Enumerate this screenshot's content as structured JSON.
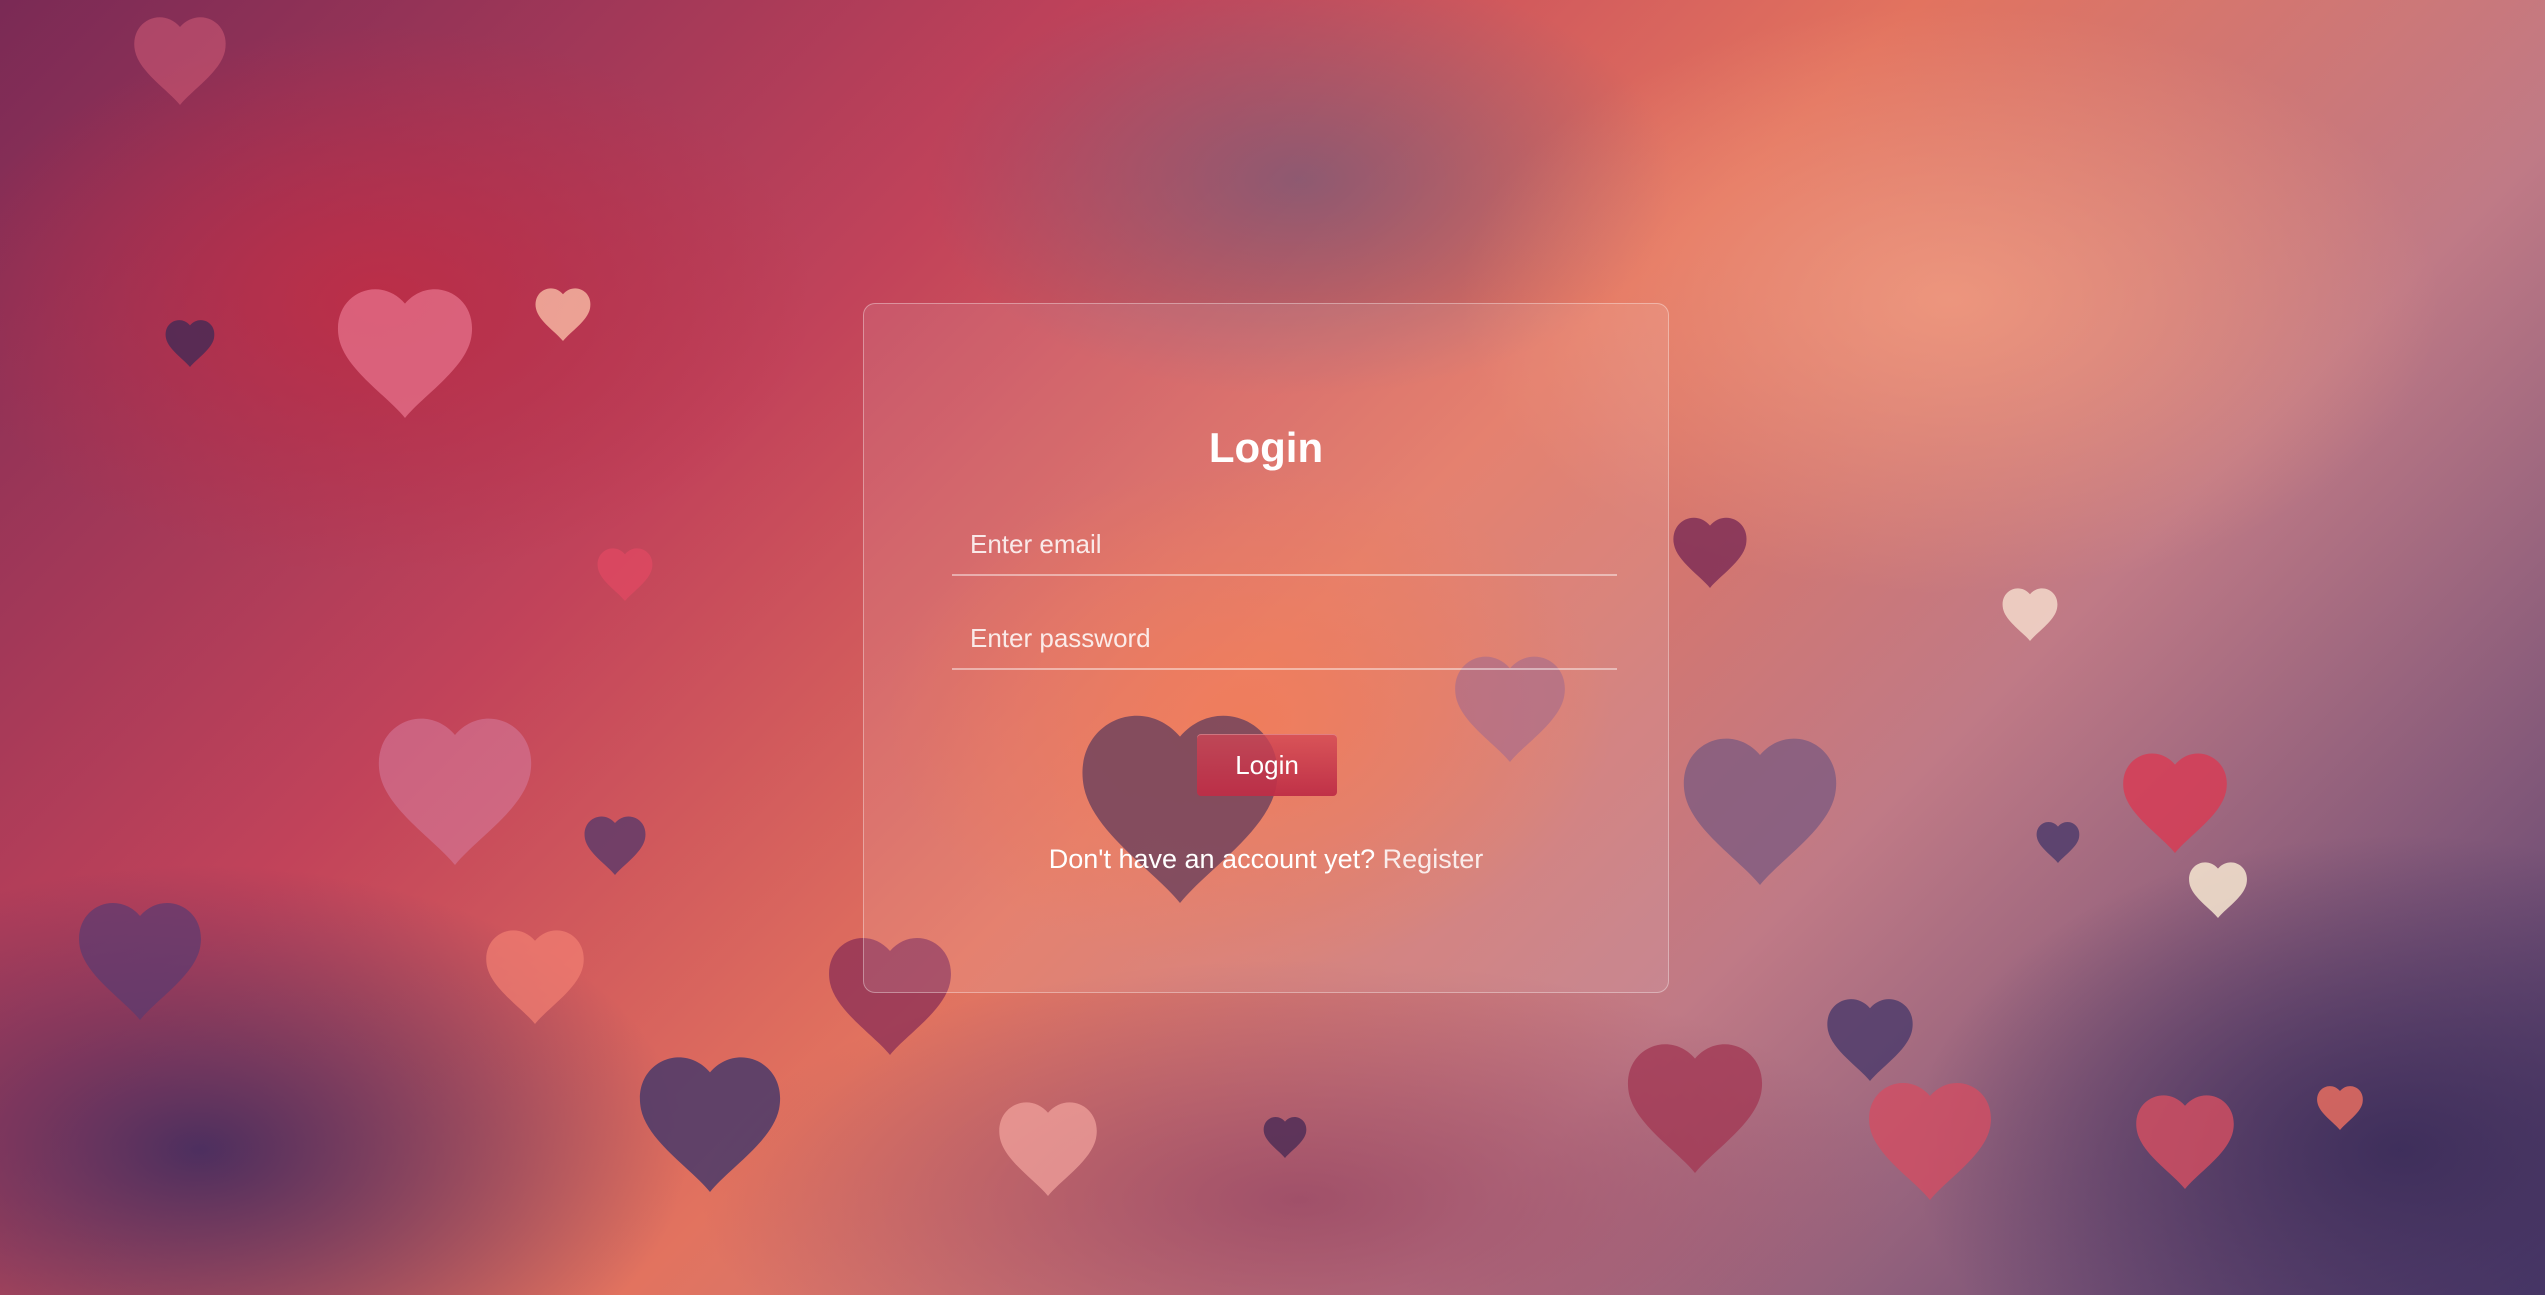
{
  "background": {
    "theme": "hearts",
    "icon": "heart-icon"
  },
  "login_form": {
    "title": "Login",
    "email_placeholder": "Enter email",
    "password_placeholder": "Enter password",
    "login_button": "Login",
    "register_prompt": "Don't have an account yet?",
    "register_link": "Register"
  },
  "colors": {
    "button": "#c8304c",
    "text": "#ffffff"
  }
}
